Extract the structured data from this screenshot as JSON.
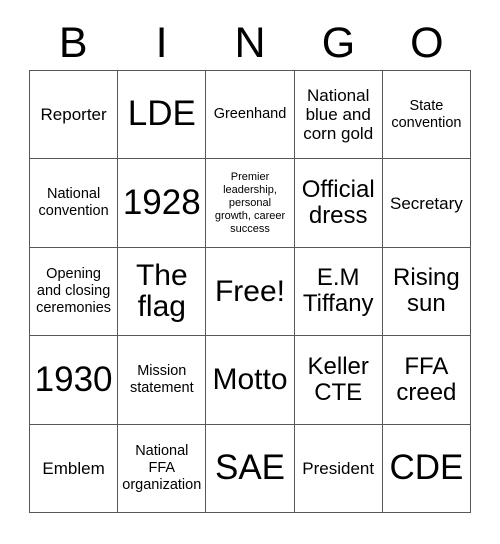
{
  "card": {
    "header_letters": [
      "B",
      "I",
      "N",
      "G",
      "O"
    ],
    "rows": [
      [
        {
          "text": "Reporter",
          "size": "md"
        },
        {
          "text": "LDE",
          "size": "xxl"
        },
        {
          "text": "Greenhand",
          "size": "sm"
        },
        {
          "text": "National blue and corn gold",
          "size": "md"
        },
        {
          "text": "State convention",
          "size": "sm"
        }
      ],
      [
        {
          "text": "National convention",
          "size": "sm"
        },
        {
          "text": "1928",
          "size": "xxl"
        },
        {
          "text": "Premier leadership, personal growth, career success",
          "size": "xs"
        },
        {
          "text": "Official dress",
          "size": "lg"
        },
        {
          "text": "Secretary",
          "size": "md"
        }
      ],
      [
        {
          "text": "Opening and closing ceremonies",
          "size": "sm"
        },
        {
          "text": "The flag",
          "size": "xl"
        },
        {
          "text": "Free!",
          "size": "xl"
        },
        {
          "text": "E.M Tiffany",
          "size": "lg"
        },
        {
          "text": "Rising sun",
          "size": "lg"
        }
      ],
      [
        {
          "text": "1930",
          "size": "xxl"
        },
        {
          "text": "Mission statement",
          "size": "sm"
        },
        {
          "text": "Motto",
          "size": "xl"
        },
        {
          "text": "Keller CTE",
          "size": "lg"
        },
        {
          "text": "FFA creed",
          "size": "lg"
        }
      ],
      [
        {
          "text": "Emblem",
          "size": "md"
        },
        {
          "text": "National FFA organization",
          "size": "sm"
        },
        {
          "text": "SAE",
          "size": "xxl"
        },
        {
          "text": "President",
          "size": "md"
        },
        {
          "text": "CDE",
          "size": "xxl"
        }
      ]
    ]
  },
  "colors": {
    "text": "#000000",
    "background": "#ffffff",
    "grid_line": "#575757"
  }
}
